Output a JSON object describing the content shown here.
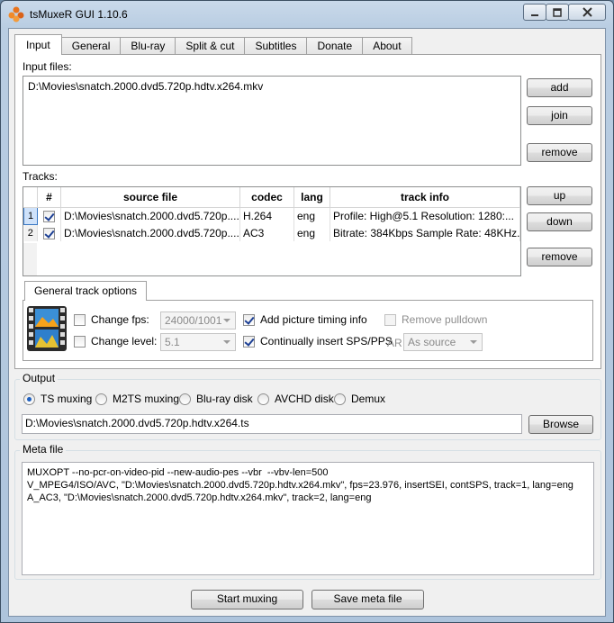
{
  "window": {
    "title": "tsMuxeR GUI 1.10.6",
    "icon": "tsmuxer-app-icon",
    "controls": [
      "minimize-icon",
      "maximize-icon",
      "close-icon"
    ]
  },
  "tabs": [
    "Input",
    "General",
    "Blu-ray",
    "Split & cut",
    "Subtitles",
    "Donate",
    "About"
  ],
  "input": {
    "files_label": "Input files:",
    "files": [
      "D:\\Movies\\snatch.2000.dvd5.720p.hdtv.x264.mkv"
    ],
    "add": "add",
    "join": "join",
    "remove_files": "remove",
    "tracks_label": "Tracks:",
    "columns": [
      "#",
      "source file",
      "codec",
      "lang",
      "track info"
    ],
    "rows": [
      {
        "num": "1",
        "source": "D:\\Movies\\snatch.2000.dvd5.720p....",
        "codec": "H.264",
        "lang": "eng",
        "info": "Profile: High@5.1  Resolution: 1280:..."
      },
      {
        "num": "2",
        "source": "D:\\Movies\\snatch.2000.dvd5.720p....",
        "codec": "AC3",
        "lang": "eng",
        "info": "Bitrate: 384Kbps Sample Rate: 48KHz..."
      }
    ],
    "up": "up",
    "down": "down",
    "remove_tracks": "remove"
  },
  "track_options": {
    "tab": "General track options",
    "change_fps": "Change fps:",
    "fps_value": "24000/1001",
    "change_level": "Change level:",
    "level_value": "5.1",
    "add_timing": "Add picture timing info",
    "insert_sps": "Continually insert SPS/PPS",
    "remove_pulldown": "Remove pulldown",
    "ar_label": "AR",
    "ar_value": "As source"
  },
  "output": {
    "label": "Output",
    "options": [
      "TS muxing",
      "M2TS muxing",
      "Blu-ray disk",
      "AVCHD disk",
      "Demux"
    ],
    "selected": 0,
    "path": "D:\\Movies\\snatch.2000.dvd5.720p.hdtv.x264.ts",
    "browse": "Browse"
  },
  "meta": {
    "label": "Meta file",
    "lines": [
      "MUXOPT --no-pcr-on-video-pid --new-audio-pes --vbr  --vbv-len=500",
      "V_MPEG4/ISO/AVC, \"D:\\Movies\\snatch.2000.dvd5.720p.hdtv.x264.mkv\", fps=23.976, insertSEI, contSPS, track=1, lang=eng",
      "A_AC3, \"D:\\Movies\\snatch.2000.dvd5.720p.hdtv.x264.mkv\", track=2, lang=eng"
    ]
  },
  "actions": {
    "start": "Start muxing",
    "save": "Save meta file"
  },
  "colors": {
    "selected_row": "#cfe2fa",
    "frame": "#b9cde2"
  }
}
